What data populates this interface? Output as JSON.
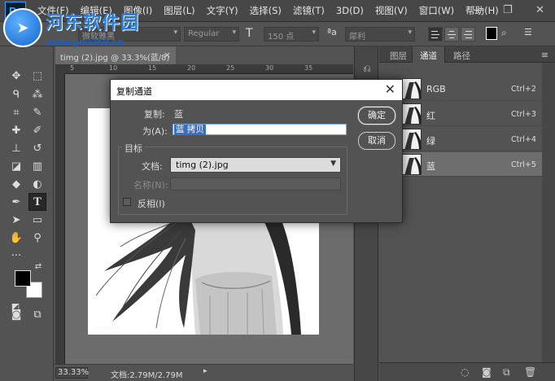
{
  "app": {
    "logo": "Ps"
  },
  "watermark": {
    "site_name": "河东软件园",
    "url": "www.pc0359.cn"
  },
  "menu": {
    "items": [
      "文件(F)",
      "编辑(E)",
      "图像(I)",
      "图层(L)",
      "文字(Y)",
      "选择(S)",
      "滤镜(T)",
      "3D(D)",
      "视图(V)",
      "窗口(W)",
      "帮助(H)"
    ]
  },
  "window_controls": {
    "minimize": "—",
    "restore": "❐",
    "close": "✕"
  },
  "options_bar": {
    "font_family": "微软雅黑",
    "font_style": "Regular",
    "font_size": "150 点",
    "antialias": "犀利",
    "text_color": "#000000"
  },
  "document": {
    "tab_title": "timg (2).jpg @ 33.3%(蓝/8)",
    "tab_close": "×",
    "ruler_numbers": [
      "5",
      "10",
      "15",
      "20",
      "25",
      "30",
      "35"
    ],
    "zoom": "33.33%",
    "doc_size": "文档:2.79M/2.79M"
  },
  "panel": {
    "tabs": [
      "图层",
      "通道",
      "路径"
    ],
    "active_tab": "通道",
    "channels": [
      {
        "name": "RGB",
        "shortcut": "Ctrl+2",
        "selected": false
      },
      {
        "name": "红",
        "shortcut": "Ctrl+3",
        "selected": false
      },
      {
        "name": "绿",
        "shortcut": "Ctrl+4",
        "selected": false
      },
      {
        "name": "蓝",
        "shortcut": "Ctrl+5",
        "selected": true
      }
    ],
    "footer_icons": [
      "load-selection-icon",
      "save-selection-icon",
      "new-channel-icon",
      "trash-icon"
    ]
  },
  "dialog": {
    "title": "复制通道",
    "close": "✕",
    "source_label": "复制:",
    "source_value": "蓝",
    "as_label": "为(A):",
    "as_value": "蓝 拷贝",
    "group_title": "目标",
    "doc_label": "文档:",
    "doc_value": "timg (2).jpg",
    "name_label": "名称(N):",
    "invert_label": "反相(I)",
    "invert_checked": false,
    "ok_label": "确定",
    "cancel_label": "取消"
  },
  "colors": {
    "foreground": "#000000",
    "background": "#ffffff",
    "selection": "#3a6fc5"
  }
}
